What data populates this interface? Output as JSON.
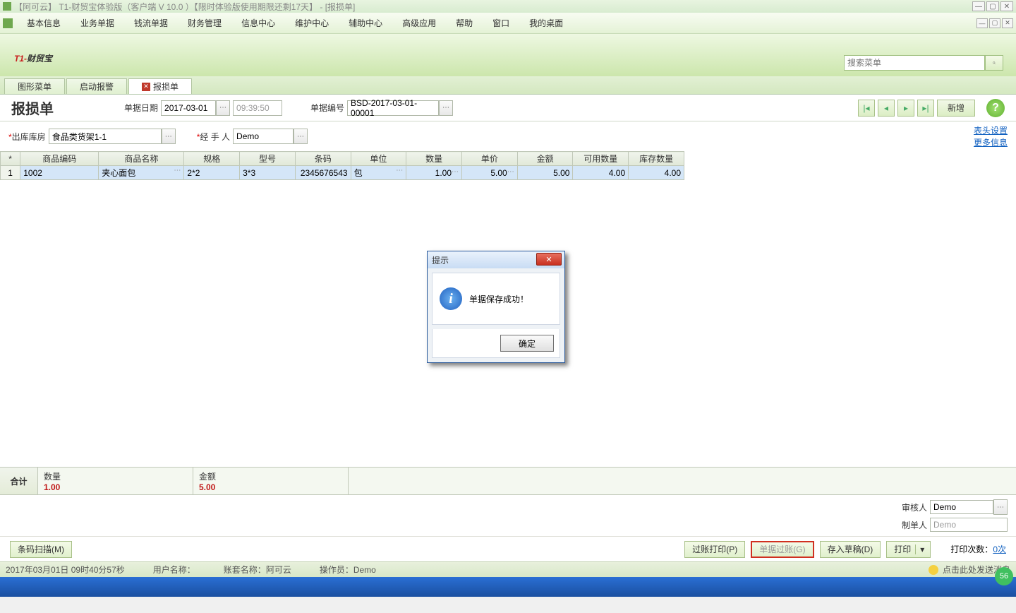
{
  "window": {
    "title": "【阿可云】 T1-财贸宝体验版（客户端 V 10.0 ）【限时体验版使用期限还剩17天】 - [报损单]"
  },
  "menubar": [
    "基本信息",
    "业务单据",
    "钱流单据",
    "财务管理",
    "信息中心",
    "维护中心",
    "辅助中心",
    "高级应用",
    "帮助",
    "窗口",
    "我的桌面"
  ],
  "brand": {
    "prefix": "T1-",
    "suffix": "财贸宝"
  },
  "search": {
    "placeholder": "搜索菜单"
  },
  "tabs": [
    {
      "label": "图形菜单",
      "closable": false
    },
    {
      "label": "启动报警",
      "closable": false
    },
    {
      "label": "报损单",
      "closable": true,
      "active": true
    }
  ],
  "doc": {
    "title": "报损单",
    "date_label": "单据日期",
    "date_value": "2017-03-01",
    "time_value": "09:39:50",
    "no_label": "单据编号",
    "no_value": "BSD-2017-03-01-00001",
    "new_btn": "新增"
  },
  "form": {
    "warehouse_label": "出库库房",
    "warehouse_value": "食品类货架1-1",
    "handler_label": "经 手 人",
    "handler_value": "Demo",
    "link_header": "表头设置",
    "link_more": "更多信息"
  },
  "table": {
    "headers": [
      "*",
      "商品编码",
      "商品名称",
      "规格",
      "型号",
      "条码",
      "单位",
      "数量",
      "单价",
      "金额",
      "可用数量",
      "库存数量"
    ],
    "row": {
      "idx": "1",
      "code": "1002",
      "name": "夹心面包",
      "spec": "2*2",
      "model": "3*3",
      "barcode": "2345676543",
      "unit": "包",
      "qty": "1.00",
      "price": "5.00",
      "amount": "5.00",
      "avail": "4.00",
      "stock": "4.00"
    }
  },
  "totals": {
    "label": "合计",
    "qty_label": "数量",
    "qty_value": "1.00",
    "amt_label": "金额",
    "amt_value": "5.00"
  },
  "footer": {
    "auditor_label": "审核人",
    "auditor_value": "Demo",
    "creator_label": "制单人",
    "creator_value": "Demo"
  },
  "actions": {
    "scan": "条码扫描(M)",
    "post_print": "过账打印(P)",
    "post": "单据过账(G)",
    "draft": "存入草稿(D)",
    "print": "打印",
    "print_count_label": "打印次数：",
    "print_count_value": "0次"
  },
  "status": {
    "datetime": "2017年03月01日   09时40分57秒",
    "user_label": "用户名称：",
    "acct_label": "账套名称：",
    "acct_value": "阿可云",
    "oper_label": "操作员：",
    "oper_value": "Demo",
    "msg": "点击此处发送消息"
  },
  "dialog": {
    "title": "提示",
    "message": "单据保存成功！",
    "ok": "确定"
  },
  "taskbar_badge": "56"
}
